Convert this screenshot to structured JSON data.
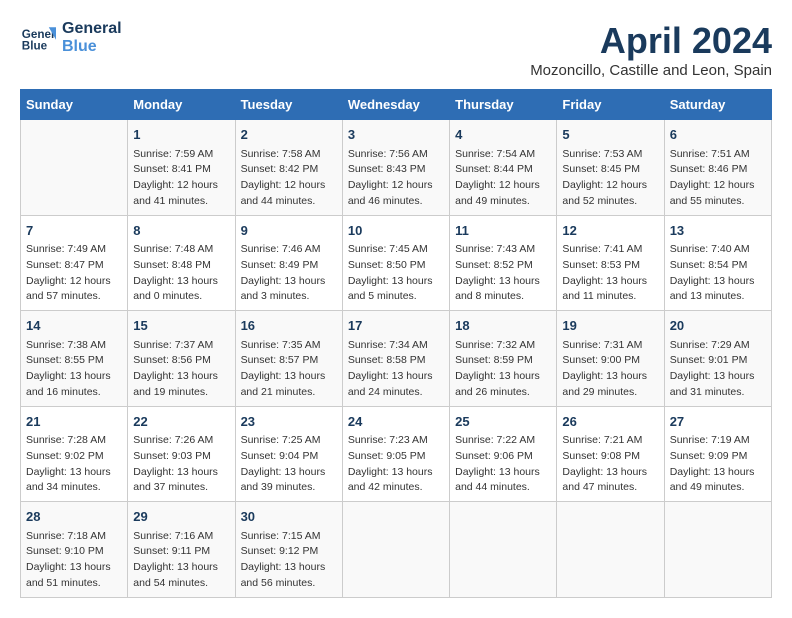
{
  "header": {
    "logo_line1": "General",
    "logo_line2": "Blue",
    "month": "April 2024",
    "location": "Mozoncillo, Castille and Leon, Spain"
  },
  "days_of_week": [
    "Sunday",
    "Monday",
    "Tuesday",
    "Wednesday",
    "Thursday",
    "Friday",
    "Saturday"
  ],
  "weeks": [
    [
      {
        "day": "",
        "lines": []
      },
      {
        "day": "1",
        "lines": [
          "Sunrise: 7:59 AM",
          "Sunset: 8:41 PM",
          "Daylight: 12 hours",
          "and 41 minutes."
        ]
      },
      {
        "day": "2",
        "lines": [
          "Sunrise: 7:58 AM",
          "Sunset: 8:42 PM",
          "Daylight: 12 hours",
          "and 44 minutes."
        ]
      },
      {
        "day": "3",
        "lines": [
          "Sunrise: 7:56 AM",
          "Sunset: 8:43 PM",
          "Daylight: 12 hours",
          "and 46 minutes."
        ]
      },
      {
        "day": "4",
        "lines": [
          "Sunrise: 7:54 AM",
          "Sunset: 8:44 PM",
          "Daylight: 12 hours",
          "and 49 minutes."
        ]
      },
      {
        "day": "5",
        "lines": [
          "Sunrise: 7:53 AM",
          "Sunset: 8:45 PM",
          "Daylight: 12 hours",
          "and 52 minutes."
        ]
      },
      {
        "day": "6",
        "lines": [
          "Sunrise: 7:51 AM",
          "Sunset: 8:46 PM",
          "Daylight: 12 hours",
          "and 55 minutes."
        ]
      }
    ],
    [
      {
        "day": "7",
        "lines": [
          "Sunrise: 7:49 AM",
          "Sunset: 8:47 PM",
          "Daylight: 12 hours",
          "and 57 minutes."
        ]
      },
      {
        "day": "8",
        "lines": [
          "Sunrise: 7:48 AM",
          "Sunset: 8:48 PM",
          "Daylight: 13 hours",
          "and 0 minutes."
        ]
      },
      {
        "day": "9",
        "lines": [
          "Sunrise: 7:46 AM",
          "Sunset: 8:49 PM",
          "Daylight: 13 hours",
          "and 3 minutes."
        ]
      },
      {
        "day": "10",
        "lines": [
          "Sunrise: 7:45 AM",
          "Sunset: 8:50 PM",
          "Daylight: 13 hours",
          "and 5 minutes."
        ]
      },
      {
        "day": "11",
        "lines": [
          "Sunrise: 7:43 AM",
          "Sunset: 8:52 PM",
          "Daylight: 13 hours",
          "and 8 minutes."
        ]
      },
      {
        "day": "12",
        "lines": [
          "Sunrise: 7:41 AM",
          "Sunset: 8:53 PM",
          "Daylight: 13 hours",
          "and 11 minutes."
        ]
      },
      {
        "day": "13",
        "lines": [
          "Sunrise: 7:40 AM",
          "Sunset: 8:54 PM",
          "Daylight: 13 hours",
          "and 13 minutes."
        ]
      }
    ],
    [
      {
        "day": "14",
        "lines": [
          "Sunrise: 7:38 AM",
          "Sunset: 8:55 PM",
          "Daylight: 13 hours",
          "and 16 minutes."
        ]
      },
      {
        "day": "15",
        "lines": [
          "Sunrise: 7:37 AM",
          "Sunset: 8:56 PM",
          "Daylight: 13 hours",
          "and 19 minutes."
        ]
      },
      {
        "day": "16",
        "lines": [
          "Sunrise: 7:35 AM",
          "Sunset: 8:57 PM",
          "Daylight: 13 hours",
          "and 21 minutes."
        ]
      },
      {
        "day": "17",
        "lines": [
          "Sunrise: 7:34 AM",
          "Sunset: 8:58 PM",
          "Daylight: 13 hours",
          "and 24 minutes."
        ]
      },
      {
        "day": "18",
        "lines": [
          "Sunrise: 7:32 AM",
          "Sunset: 8:59 PM",
          "Daylight: 13 hours",
          "and 26 minutes."
        ]
      },
      {
        "day": "19",
        "lines": [
          "Sunrise: 7:31 AM",
          "Sunset: 9:00 PM",
          "Daylight: 13 hours",
          "and 29 minutes."
        ]
      },
      {
        "day": "20",
        "lines": [
          "Sunrise: 7:29 AM",
          "Sunset: 9:01 PM",
          "Daylight: 13 hours",
          "and 31 minutes."
        ]
      }
    ],
    [
      {
        "day": "21",
        "lines": [
          "Sunrise: 7:28 AM",
          "Sunset: 9:02 PM",
          "Daylight: 13 hours",
          "and 34 minutes."
        ]
      },
      {
        "day": "22",
        "lines": [
          "Sunrise: 7:26 AM",
          "Sunset: 9:03 PM",
          "Daylight: 13 hours",
          "and 37 minutes."
        ]
      },
      {
        "day": "23",
        "lines": [
          "Sunrise: 7:25 AM",
          "Sunset: 9:04 PM",
          "Daylight: 13 hours",
          "and 39 minutes."
        ]
      },
      {
        "day": "24",
        "lines": [
          "Sunrise: 7:23 AM",
          "Sunset: 9:05 PM",
          "Daylight: 13 hours",
          "and 42 minutes."
        ]
      },
      {
        "day": "25",
        "lines": [
          "Sunrise: 7:22 AM",
          "Sunset: 9:06 PM",
          "Daylight: 13 hours",
          "and 44 minutes."
        ]
      },
      {
        "day": "26",
        "lines": [
          "Sunrise: 7:21 AM",
          "Sunset: 9:08 PM",
          "Daylight: 13 hours",
          "and 47 minutes."
        ]
      },
      {
        "day": "27",
        "lines": [
          "Sunrise: 7:19 AM",
          "Sunset: 9:09 PM",
          "Daylight: 13 hours",
          "and 49 minutes."
        ]
      }
    ],
    [
      {
        "day": "28",
        "lines": [
          "Sunrise: 7:18 AM",
          "Sunset: 9:10 PM",
          "Daylight: 13 hours",
          "and 51 minutes."
        ]
      },
      {
        "day": "29",
        "lines": [
          "Sunrise: 7:16 AM",
          "Sunset: 9:11 PM",
          "Daylight: 13 hours",
          "and 54 minutes."
        ]
      },
      {
        "day": "30",
        "lines": [
          "Sunrise: 7:15 AM",
          "Sunset: 9:12 PM",
          "Daylight: 13 hours",
          "and 56 minutes."
        ]
      },
      {
        "day": "",
        "lines": []
      },
      {
        "day": "",
        "lines": []
      },
      {
        "day": "",
        "lines": []
      },
      {
        "day": "",
        "lines": []
      }
    ]
  ]
}
